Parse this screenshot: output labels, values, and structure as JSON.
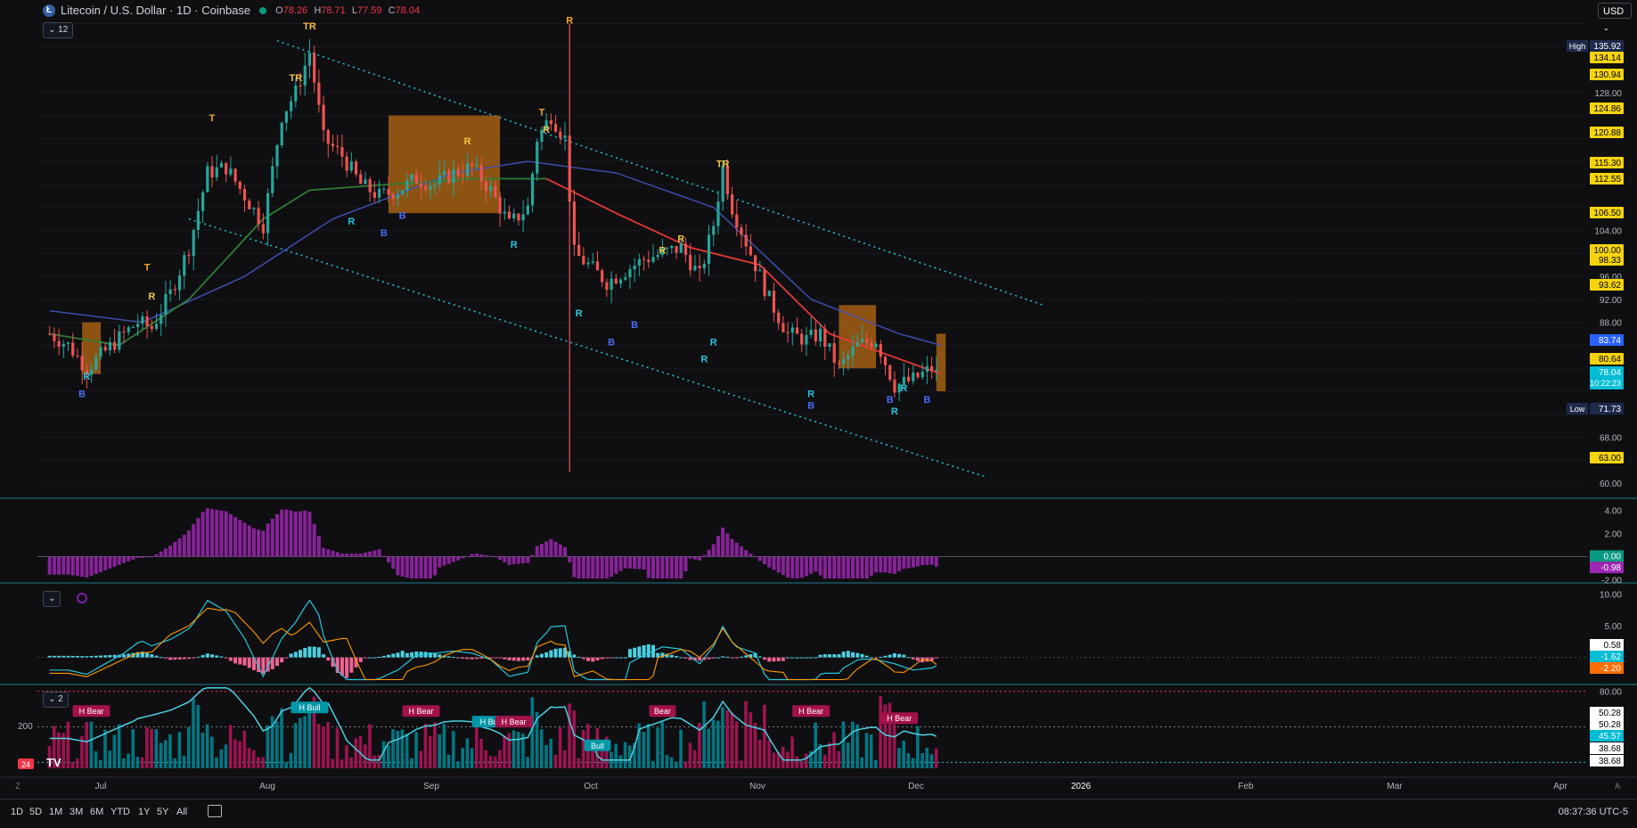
{
  "header": {
    "symbol_icon": "litecoin-logo-icon",
    "title": "Litecoin / U.S. Dollar · 1D · Coinbase",
    "ohlc": {
      "o_label": "O",
      "o": "78.26",
      "h_label": "H",
      "h": "78.71",
      "l_label": "L",
      "l": "77.59",
      "c_label": "C",
      "c": "78.04"
    },
    "indicators_toggle": "12"
  },
  "currency_button": "USD",
  "chart_data": {
    "type": "line",
    "title": "Litecoin / U.S. Dollar · 1D · Coinbase",
    "x_ticks": [
      "Jul",
      "Aug",
      "Sep",
      "Oct",
      "Nov",
      "Dec",
      "2026",
      "Feb",
      "Mar",
      "Apr"
    ],
    "y_ticks": [
      "128.00",
      "104.00",
      "96.00",
      "92.00",
      "88.00",
      "68.00",
      "60.00"
    ],
    "ylim": [
      58,
      141
    ],
    "price_path": [
      [
        "Jun 20",
        86
      ],
      [
        "Jun 24",
        84
      ],
      [
        "Jun 28",
        80
      ],
      [
        "Jul 2",
        83
      ],
      [
        "Jul 6",
        86
      ],
      [
        "Jul 9",
        88
      ],
      [
        "Jul 12",
        87
      ],
      [
        "Jul 16",
        93
      ],
      [
        "Jul 20",
        101
      ],
      [
        "Jul 24",
        114
      ],
      [
        "Jul 28",
        115
      ],
      [
        "Aug 1",
        110
      ],
      [
        "Aug 5",
        105
      ],
      [
        "Aug 9",
        124
      ],
      [
        "Aug 12",
        128
      ],
      [
        "Aug 15",
        135
      ],
      [
        "Aug 18",
        120
      ],
      [
        "Aug 22",
        117
      ],
      [
        "Aug 26",
        112
      ],
      [
        "Aug 30",
        110
      ],
      [
        "Sep 3",
        111
      ],
      [
        "Sep 7",
        113
      ],
      [
        "Sep 11",
        112
      ],
      [
        "Sep 15",
        114
      ],
      [
        "Sep 19",
        115
      ],
      [
        "Sep 23",
        111
      ],
      [
        "Sep 27",
        105
      ],
      [
        "Oct 1",
        108
      ],
      [
        "Oct 3",
        120
      ],
      [
        "Oct 6",
        124
      ],
      [
        "Oct 9",
        120
      ],
      [
        "Oct 11",
        100
      ],
      [
        "Oct 14",
        98
      ],
      [
        "Oct 18",
        95
      ],
      [
        "Oct 22",
        97
      ],
      [
        "Oct 26",
        99
      ],
      [
        "Oct 30",
        100
      ],
      [
        "Nov 3",
        101
      ],
      [
        "Nov 7",
        96
      ],
      [
        "Nov 10",
        105
      ],
      [
        "Nov 12",
        115
      ],
      [
        "Nov 14",
        108
      ],
      [
        "Nov 18",
        100
      ],
      [
        "Nov 22",
        92
      ],
      [
        "Nov 26",
        86
      ],
      [
        "Nov 30",
        85
      ],
      [
        "Dec 3",
        86
      ],
      [
        "Dec 7",
        80
      ],
      [
        "Dec 11",
        84
      ],
      [
        "Dec 15",
        85
      ],
      [
        "Dec 19",
        77
      ],
      [
        "Dec 23",
        78
      ],
      [
        "Dec 27",
        80
      ],
      [
        "Dec 29",
        78.04
      ]
    ],
    "ma_fast": [
      [
        "Jun 20",
        86
      ],
      [
        "Jul 5",
        84
      ],
      [
        "Jul 20",
        92
      ],
      [
        "Aug 5",
        106
      ],
      [
        "Aug 15",
        111
      ],
      [
        "Sep 1",
        112
      ],
      [
        "Sep 20",
        113
      ],
      [
        "Oct 5",
        113
      ],
      [
        "Oct 20",
        107
      ],
      [
        "Nov 5",
        101
      ],
      [
        "Nov 20",
        98
      ],
      [
        "Dec 5",
        86
      ],
      [
        "Dec 29",
        79
      ]
    ],
    "ma_slow": [
      [
        "Jun 20",
        90
      ],
      [
        "Jul 10",
        88
      ],
      [
        "Aug 1",
        96
      ],
      [
        "Aug 20",
        106
      ],
      [
        "Sep 15",
        114
      ],
      [
        "Oct 1",
        116
      ],
      [
        "Oct 20",
        114
      ],
      [
        "Nov 10",
        108
      ],
      [
        "Dec 1",
        92
      ],
      [
        "Dec 20",
        86
      ],
      [
        "Dec 29",
        84
      ]
    ],
    "channel_upper": [
      [
        "Aug 8",
        137
      ],
      [
        "Jan 20",
        91
      ]
    ],
    "channel_lower": [
      [
        "Jul 20",
        106
      ],
      [
        "Jan 8",
        61
      ]
    ],
    "signal_labels": [
      {
        "x": "Jul 11",
        "y": 97,
        "t": "T",
        "c": "#f5a623"
      },
      {
        "x": "Jul 12",
        "y": 92,
        "t": "R",
        "c": "#f5c242"
      },
      {
        "x": "Jul 25",
        "y": 123,
        "t": "T",
        "c": "#f5a623"
      },
      {
        "x": "Aug 12",
        "y": 130,
        "t": "TR",
        "c": "#f5c242"
      },
      {
        "x": "Aug 15",
        "y": 139,
        "t": "TR",
        "c": "#f5c242"
      },
      {
        "x": "Sep 18",
        "y": 119,
        "t": "R",
        "c": "#f5c242"
      },
      {
        "x": "Oct 4",
        "y": 124,
        "t": "T",
        "c": "#f5a623"
      },
      {
        "x": "Oct 5",
        "y": 121,
        "t": "R",
        "c": "#f5c242"
      },
      {
        "x": "Oct 10",
        "y": 140,
        "t": "R",
        "c": "#f5a623"
      },
      {
        "x": "Nov 12",
        "y": 115,
        "t": "TR",
        "c": "#f5c242"
      },
      {
        "x": "Nov 3",
        "y": 102,
        "t": "R",
        "c": "#f5c242"
      },
      {
        "x": "Oct 30",
        "y": 100,
        "t": "R",
        "c": "#f5c242"
      },
      {
        "x": "Jun 28",
        "y": 78,
        "t": "R",
        "c": "#26c6da"
      },
      {
        "x": "Jun 27",
        "y": 75,
        "t": "B",
        "c": "#4a6cf7"
      },
      {
        "x": "Aug 24",
        "y": 105,
        "t": "R",
        "c": "#26c6da"
      },
      {
        "x": "Aug 31",
        "y": 103,
        "t": "B",
        "c": "#4a6cf7"
      },
      {
        "x": "Sep 4",
        "y": 106,
        "t": "B",
        "c": "#4a6cf7"
      },
      {
        "x": "Sep 28",
        "y": 101,
        "t": "R",
        "c": "#26c6da"
      },
      {
        "x": "Oct 12",
        "y": 89,
        "t": "R",
        "c": "#26c6da"
      },
      {
        "x": "Oct 19",
        "y": 84,
        "t": "B",
        "c": "#4a6cf7"
      },
      {
        "x": "Oct 24",
        "y": 87,
        "t": "B",
        "c": "#4a6cf7"
      },
      {
        "x": "Nov 8",
        "y": 81,
        "t": "R",
        "c": "#26c6da"
      },
      {
        "x": "Nov 10",
        "y": 84,
        "t": "R",
        "c": "#26c6da"
      },
      {
        "x": "Dec 1",
        "y": 75,
        "t": "R",
        "c": "#26c6da"
      },
      {
        "x": "Dec 1",
        "y": 73,
        "t": "B",
        "c": "#4a6cf7"
      },
      {
        "x": "Dec 18",
        "y": 74,
        "t": "B",
        "c": "#4a6cf7"
      },
      {
        "x": "Dec 19",
        "y": 72,
        "t": "R",
        "c": "#26c6da"
      },
      {
        "x": "Dec 21",
        "y": 76,
        "t": "R",
        "c": "#26c6da"
      },
      {
        "x": "Dec 26",
        "y": 74,
        "t": "B",
        "c": "#4a6cf7"
      }
    ],
    "price_boxes": [
      {
        "label": "High",
        "value": "135.92",
        "kind": "high"
      },
      {
        "value": "134.14",
        "kind": "level"
      },
      {
        "value": "130.94",
        "kind": "level"
      },
      {
        "value": "124.86",
        "kind": "level"
      },
      {
        "value": "120.88",
        "kind": "level"
      },
      {
        "value": "115.30",
        "kind": "level"
      },
      {
        "value": "112.55",
        "kind": "level"
      },
      {
        "value": "106.50",
        "kind": "level"
      },
      {
        "value": "100.00",
        "kind": "level"
      },
      {
        "value": "98.33",
        "kind": "level"
      },
      {
        "value": "93.62",
        "kind": "level"
      },
      {
        "value": "83.74",
        "kind": "blue"
      },
      {
        "value": "80.64",
        "kind": "level"
      },
      {
        "value": "78.04",
        "kind": "current",
        "countdown": "10:22:23"
      },
      {
        "label": "Low",
        "value": "71.73",
        "kind": "low"
      },
      {
        "value": "63.00",
        "kind": "level"
      }
    ],
    "osc1": {
      "y_ticks": [
        "4.00",
        "2.00",
        "-2.00"
      ],
      "ylim": [
        -2.2,
        4.8
      ],
      "last": "0.00",
      "last2": "-0.98"
    },
    "osc2": {
      "y_ticks": [
        "10.00",
        "5.00"
      ],
      "ylim": [
        -4,
        11.5
      ],
      "last_hist": "0.58",
      "last_macd": "-1.62",
      "last_signal": "-2.20",
      "toggle_icon": "settings-gear-icon"
    },
    "osc3": {
      "y_ticks": [
        "80.00"
      ],
      "left_label": "200",
      "ylim": [
        15,
        85
      ],
      "right_boxes": [
        "50.28",
        "50.28",
        "45.57",
        "38.68",
        "38.68"
      ],
      "divergence_labels": [
        {
          "x": "Jun 29",
          "y": 63,
          "t": "H Bear",
          "c": "#a3124a"
        },
        {
          "x": "Aug 15",
          "y": 66,
          "t": "H Bull",
          "c": "#0097a7"
        },
        {
          "x": "Sep 8",
          "y": 63,
          "t": "H Bear",
          "c": "#a3124a"
        },
        {
          "x": "Sep 23",
          "y": 54,
          "t": "H Bull",
          "c": "#0097a7"
        },
        {
          "x": "Sep 28",
          "y": 54,
          "t": "H Bear",
          "c": "#a3124a"
        },
        {
          "x": "Oct 16",
          "y": 34,
          "t": "Bull",
          "c": "#0097a7"
        },
        {
          "x": "Oct 30",
          "y": 63,
          "t": "Bear",
          "c": "#a3124a"
        },
        {
          "x": "Dec 1",
          "y": 63,
          "t": "H Bear",
          "c": "#a3124a"
        },
        {
          "x": "Dec 20",
          "y": 57,
          "t": "H Bear",
          "c": "#a3124a"
        }
      ],
      "toggle": "2"
    }
  },
  "bottom": {
    "timeframes": [
      "1D",
      "5D",
      "1M",
      "3M",
      "6M",
      "YTD",
      "1Y",
      "5Y",
      "All"
    ],
    "calendar_icon": "calendar-range-icon",
    "clock": "08:37:36 UTC-5",
    "z_label": "Z",
    "a_label": "A",
    "logo": "TV",
    "badge": "24"
  },
  "colors": {
    "bg": "#0f0f12",
    "up": "#26a69a",
    "down": "#ef5350",
    "orange": "#f5a623",
    "ma_fast_green": "#2e7d32",
    "ma_fast_red": "#e53935",
    "ma_slow": "#3f51b5",
    "channel": "#26c6da",
    "osc_purple": "#9c27b0"
  }
}
